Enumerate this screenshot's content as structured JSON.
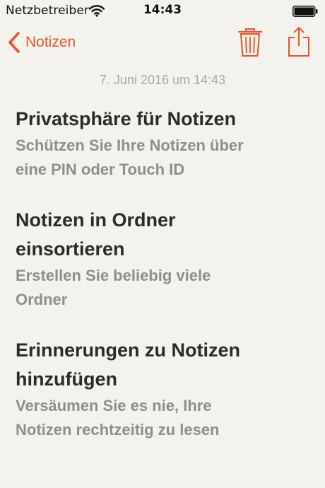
{
  "status_bar": {
    "carrier": "Netzbetreiber",
    "time": "14:43",
    "wifi_icon": "wifi-icon",
    "battery_icon": "battery-icon"
  },
  "nav": {
    "back_label": "Notizen",
    "back_icon": "chevron-left-icon",
    "trash_icon": "trash-icon",
    "share_icon": "share-icon",
    "accent_color": "#e8542a"
  },
  "note": {
    "date": "7. Juni 2016 um 14:43",
    "sections": [
      {
        "title_lines": [
          "Privatsphäre für Notizen"
        ],
        "text_lines": [
          "Schützen Sie Ihre Notizen über",
          "eine PIN oder Touch ID"
        ]
      },
      {
        "title_lines": [
          "Notizen in Ordner",
          "einsortieren"
        ],
        "text_lines": [
          "Erstellen Sie beliebig viele",
          "Ordner"
        ]
      },
      {
        "title_lines": [
          "Erinnerungen zu Notizen",
          "hinzufügen"
        ],
        "text_lines": [
          "Versäumen Sie es nie, Ihre",
          "Notizen rechtzeitig zu lesen"
        ]
      }
    ]
  }
}
